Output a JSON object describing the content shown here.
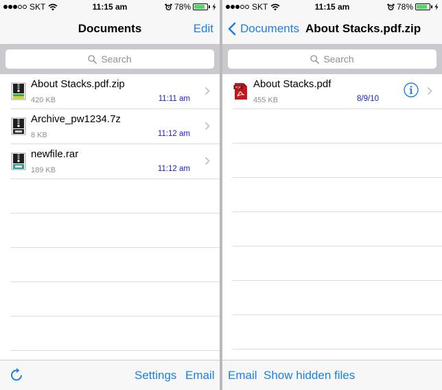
{
  "colors": {
    "accent": "#1a7fe6",
    "date_text": "#1a1acc",
    "battery": "#4cd964",
    "pdf_red": "#c4161c",
    "archive_green": "#3aa845"
  },
  "status": {
    "carrier": "SKT",
    "time": "11:15 am",
    "battery": "78%"
  },
  "left": {
    "nav": {
      "title": "Documents",
      "edit_label": "Edit"
    },
    "search_placeholder": "Search",
    "files": [
      {
        "name": "About Stacks.pdf.zip",
        "size": "420 KB",
        "date": "11:11 am",
        "icon": "zip-archive-icon"
      },
      {
        "name": "Archive_pw1234.7z",
        "size": "8 KB",
        "date": "11:12 am",
        "icon": "7z-archive-icon"
      },
      {
        "name": "newfile.rar",
        "size": "189 KB",
        "date": "11:12 am",
        "icon": "rar-archive-icon"
      }
    ],
    "toolbar": {
      "settings_label": "Settings",
      "email_label": "Email"
    }
  },
  "right": {
    "nav": {
      "back_label": "Documents",
      "title": "About Stacks.pdf.zip"
    },
    "search_placeholder": "Search",
    "files": [
      {
        "name": "About Stacks.pdf",
        "size": "455 KB",
        "date": "8/9/10",
        "icon": "pdf-file-icon"
      }
    ],
    "toolbar": {
      "email_label": "Email",
      "hidden_files_label": "Show hidden files"
    }
  }
}
